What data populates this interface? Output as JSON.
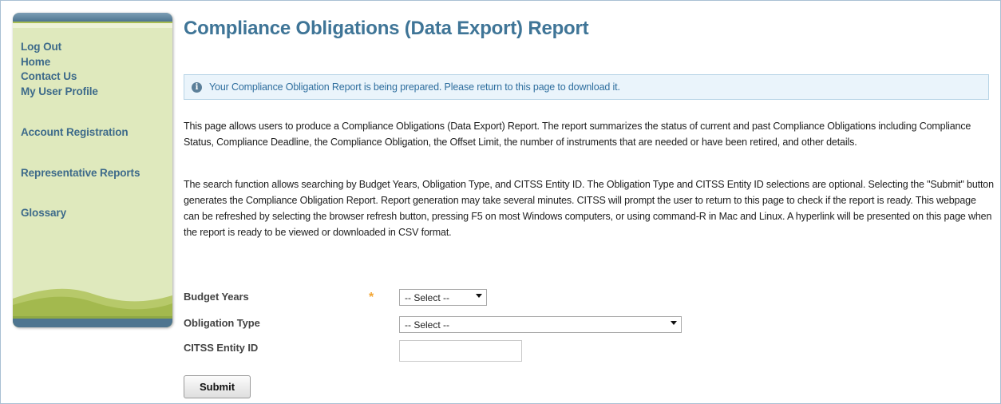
{
  "sidebar": {
    "links": [
      {
        "label": "Log Out"
      },
      {
        "label": "Home"
      },
      {
        "label": "Contact Us"
      },
      {
        "label": "My User Profile"
      },
      {
        "label": "Account Registration"
      },
      {
        "label": "Representative Reports"
      },
      {
        "label": "Glossary"
      }
    ]
  },
  "page": {
    "title": "Compliance Obligations (Data Export) Report"
  },
  "banner": {
    "icon": "info-icon",
    "text": "Your Compliance Obligation Report is being prepared. Please return to this page to download it."
  },
  "content": {
    "paragraph1": "This page allows users to produce a Compliance Obligations (Data Export) Report. The report summarizes the status of current and past Compliance Obligations including Compliance Status, Compliance Deadline, the Compliance Obligation, the Offset Limit, the number of instruments that are needed or have been retired, and other details.",
    "paragraph2": "The search function allows searching by Budget Years, Obligation Type, and CITSS Entity ID. The Obligation Type and CITSS Entity ID selections are optional. Selecting the \"Submit\" button generates the Compliance Obligation Report. Report generation may take several minutes. CITSS will prompt the user to return to this page to check if the report is ready. This webpage can be refreshed by selecting the browser refresh button, pressing F5 on most Windows computers, or using command-R in Mac and Linux. A hyperlink will be presented on this page when the report is ready to be viewed or downloaded in CSV format."
  },
  "form": {
    "budget_years": {
      "label": "Budget Years",
      "required_marker": "*",
      "selected": "-- Select --"
    },
    "obligation_type": {
      "label": "Obligation Type",
      "selected": "-- Select --"
    },
    "citss_entity_id": {
      "label": "CITSS Entity ID",
      "value": ""
    },
    "submit_label": "Submit"
  },
  "colors": {
    "title": "#3f7597",
    "nav_link": "#3d6a8a",
    "sidebar_bg": "#dfe9bd",
    "banner_bg": "#eaf4fb",
    "banner_text": "#2e6e9e",
    "required_star": "#f3a532"
  }
}
